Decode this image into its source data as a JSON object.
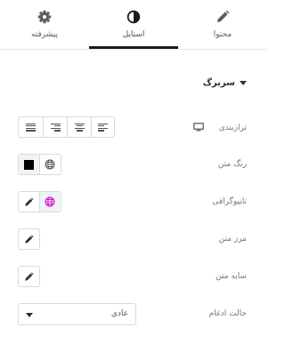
{
  "tabs": [
    {
      "label": "محتوا",
      "icon": "pencil-icon"
    },
    {
      "label": "استایل",
      "icon": "contrast-icon",
      "active": true
    },
    {
      "label": "پیشرفته",
      "icon": "gear-icon"
    }
  ],
  "section": {
    "title": "سربرگ"
  },
  "controls": {
    "alignment": {
      "label": "ترازبندی",
      "options": [
        "justify",
        "right",
        "center",
        "left"
      ]
    },
    "text_color": {
      "label": "رنگ متن",
      "swatch": "#000000"
    },
    "typography": {
      "label": "تایپوگرافی",
      "accent": "#d004d4"
    },
    "text_stroke": {
      "label": "مرز متن"
    },
    "text_shadow": {
      "label": "سایه متن"
    },
    "blend_mode": {
      "label": "حالت ادغام",
      "value": "عادی"
    }
  }
}
